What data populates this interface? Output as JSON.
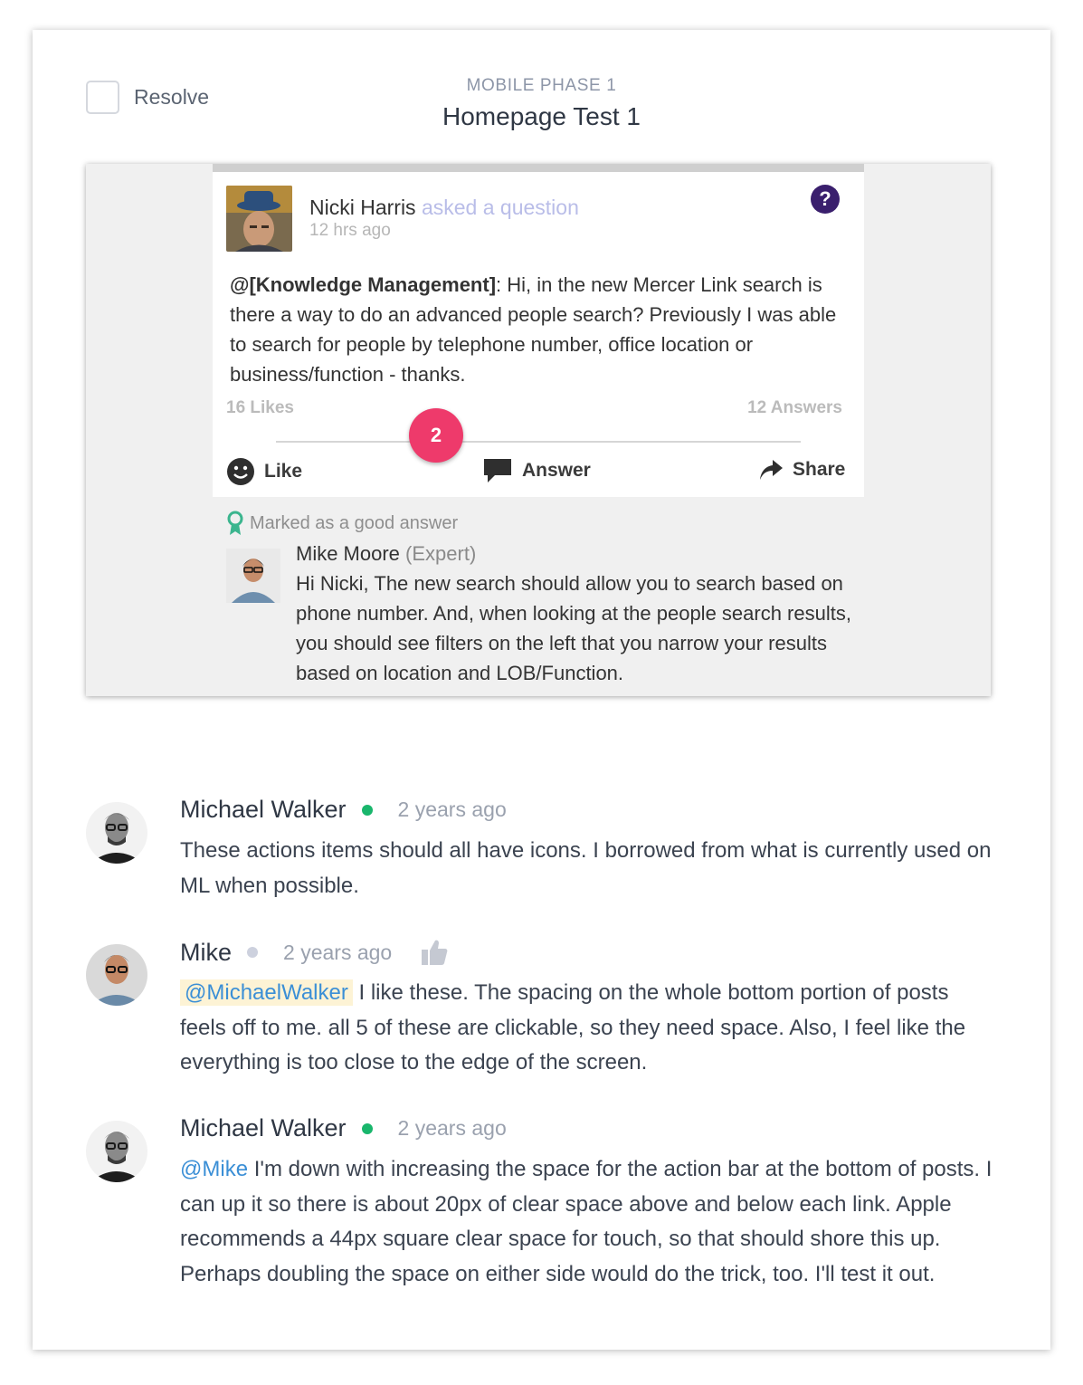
{
  "header": {
    "resolve_label": "Resolve",
    "phase": "MOBILE PHASE 1",
    "title": "Homepage Test 1"
  },
  "screenshot": {
    "post": {
      "author": "Nicki Harris",
      "verb": "asked a question",
      "time": "12 hrs ago",
      "mention": "@[Knowledge Management]",
      "body": ": Hi, in the new Mercer Link search is there a way to do an advanced people search? Previously I was able to search for people by telephone number, office location or business/function - thanks.",
      "likes": "16 Likes",
      "answers": "12 Answers",
      "icon": "question-icon",
      "actions": {
        "like": "Like",
        "answer": "Answer",
        "share": "Share"
      }
    },
    "marker": "2",
    "good_answer": "Marked as a good answer",
    "answer": {
      "author": "Mike Moore",
      "role": "(Expert)",
      "body": "Hi Nicki, The new search should allow you to search based on phone number. And, when looking at the people search results, you should see filters on the left that you narrow your results based on location and LOB/Function."
    }
  },
  "comments": [
    {
      "name": "Michael Walker",
      "status": "online",
      "time": "2 years ago",
      "text": "These actions items should all have icons. I borrowed from what is currently used on ML when possible."
    },
    {
      "name": "Mike",
      "status": "offline",
      "time": "2 years ago",
      "mention": "@MichaelWalker",
      "text": " I like these. The spacing on the whole bottom portion of posts feels off to me. all 5 of these are clickable, so they need space. Also, I feel like the everything is too close to the edge of the screen."
    },
    {
      "name": "Michael Walker",
      "status": "online",
      "time": "2 years ago",
      "mention": "@Mike",
      "text": " I'm down with increasing the space for the action bar at the bottom of posts. I can up it so there is about 20px of clear space above and below each link. Apple recommends a 44px square clear space for touch, so that should shore this up. Perhaps doubling the space on either side would do the trick, too. I'll test it out."
    }
  ],
  "colors": {
    "online": "#19b66c",
    "offline": "#cdd1de",
    "mention": "#3b8fd6",
    "marker": "#ee3a6b",
    "question": "#3a1f6d"
  }
}
